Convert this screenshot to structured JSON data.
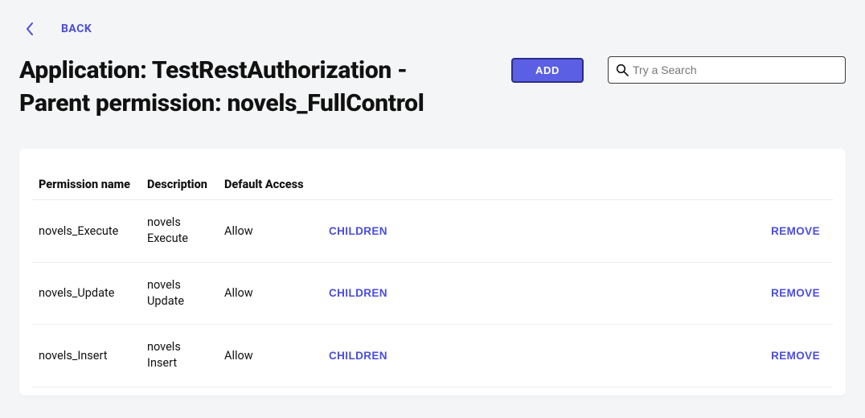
{
  "nav": {
    "back_label": "BACK"
  },
  "header": {
    "title": "Application: TestRestAuthorization - Parent permission: novels_FullControl",
    "add_label": "ADD",
    "search_placeholder": "Try a Search"
  },
  "table": {
    "columns": {
      "name": "Permission name",
      "description": "Description",
      "access": "Default Access"
    },
    "actions": {
      "children": "CHILDREN",
      "remove": "REMOVE"
    },
    "rows": [
      {
        "name": "novels_Execute",
        "description": "novels Execute",
        "access": "Allow"
      },
      {
        "name": "novels_Update",
        "description": "novels Update",
        "access": "Allow"
      },
      {
        "name": "novels_Insert",
        "description": "novels Insert",
        "access": "Allow"
      }
    ]
  }
}
